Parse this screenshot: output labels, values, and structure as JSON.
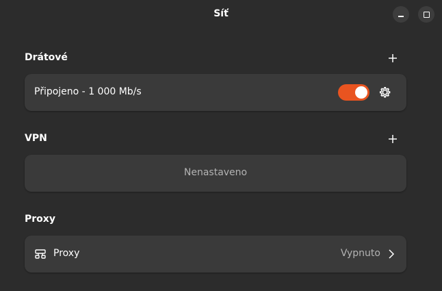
{
  "window": {
    "title": "Síť"
  },
  "wired": {
    "title": "Drátové",
    "connection_label": "Připojeno - 1 000 Mb/s",
    "toggle_on": true
  },
  "vpn": {
    "title": "VPN",
    "empty_label": "Nenastaveno"
  },
  "proxy": {
    "title": "Proxy",
    "row_label": "Proxy",
    "status": "Vypnuto"
  },
  "colors": {
    "background": "#2c2c2c",
    "card": "#3a3a3a",
    "accent": "#e95420",
    "muted_text": "#b3b3b3"
  },
  "icons": {
    "add": "plus-icon",
    "settings": "gear-icon",
    "proxy": "proxy-icon",
    "chevron": "chevron-right-icon",
    "minimize": "minimize-icon",
    "maximize": "maximize-icon"
  }
}
